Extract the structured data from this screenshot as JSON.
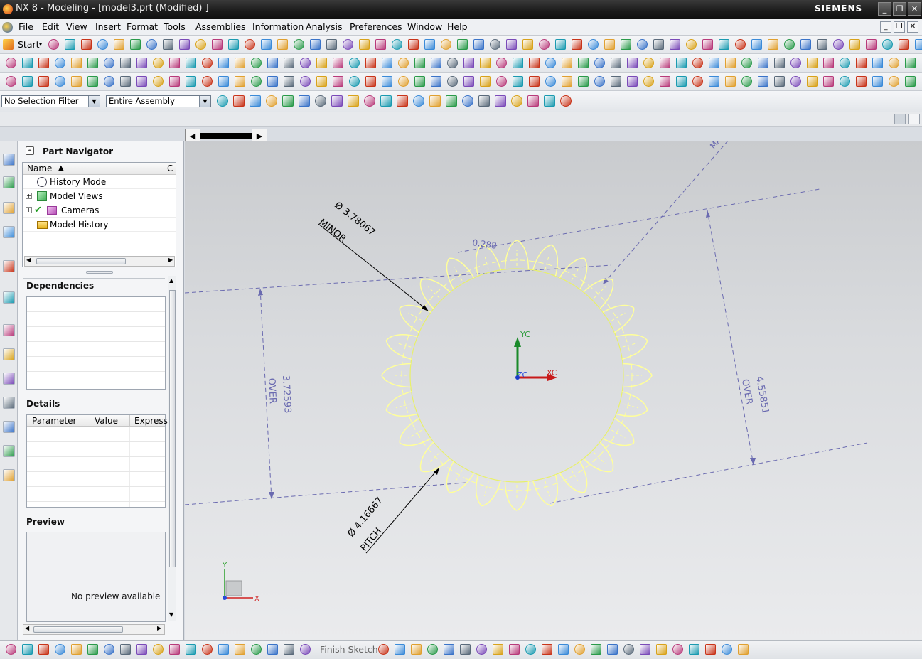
{
  "window": {
    "title": "NX 8 - Modeling - [model3.prt (Modified) ]",
    "brand": "SIEMENS",
    "controls": {
      "minimize": "_",
      "restore": "❐",
      "close": "✕"
    }
  },
  "menu": {
    "items": [
      "File",
      "Edit",
      "View",
      "Insert",
      "Format",
      "Tools",
      "Assemblies",
      "Information",
      "Analysis",
      "Preferences",
      "Window",
      "Help"
    ],
    "mdi": {
      "minimize": "_",
      "restore": "❐",
      "close": "✕"
    }
  },
  "toolbar": {
    "start_label": "Start"
  },
  "selection": {
    "filter_value": "No Selection Filter",
    "scope_value": "Entire Assembly"
  },
  "part_navigator": {
    "title": "Part Navigator",
    "columns": [
      "Name",
      "C"
    ],
    "items": [
      "History Mode",
      "Model Views",
      "Cameras",
      "Model History"
    ]
  },
  "dependencies": {
    "title": "Dependencies"
  },
  "details": {
    "title": "Details",
    "columns": [
      "Parameter",
      "Value",
      "Express"
    ]
  },
  "preview": {
    "title": "Preview",
    "empty_text": "No preview available"
  },
  "viewport": {
    "dimensions": {
      "minor": "Ø 3.78067",
      "minor_label": "MINOR",
      "pitch": "Ø 4.16667",
      "pitch_label": "PITCH",
      "over_left": "3.72593",
      "over_left_label": "OVER",
      "over_right": "4.55851",
      "over_right_label": "OVER",
      "small": "0.288",
      "major_label": "MA"
    },
    "wcs": {
      "x": "XC",
      "y": "YC",
      "z": "ZC"
    },
    "triad": {
      "x": "X",
      "y": "Y"
    },
    "colors": {
      "gear": "#ffff9a",
      "dimension": "#6a6ab0",
      "leader": "#000000",
      "background": "#d9dbde"
    }
  },
  "statusbar": {
    "finish_sketch_label": "Finish Sketch"
  }
}
